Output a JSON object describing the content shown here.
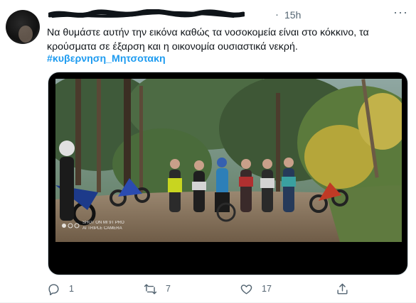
{
  "tweet": {
    "time": "15h",
    "separator": "·",
    "more": "···",
    "text_line1": "Να θυμάστε αυτήν την εικόνα καθώς τα νοσοκομεία είναι στο κόκκινο, τα",
    "text_line2": "κρούσματα σε έξαρση και η οικονομία ουσιαστικά νεκρή.",
    "hashtag": "#κυβερνηση_Μητσοτακη",
    "photo_watermark_line1": "SHOT ON MI 9T PRO",
    "photo_watermark_line2": "AI TRIPLE CAMERA",
    "actions": {
      "reply_count": "1",
      "retweet_count": "7",
      "like_count": "17"
    }
  },
  "colors": {
    "accent": "#1d9bf0",
    "secondary_text": "#536471",
    "primary_text": "#0f1419"
  },
  "icons": [
    "reply-icon",
    "retweet-icon",
    "like-icon",
    "share-icon",
    "more-icon"
  ]
}
